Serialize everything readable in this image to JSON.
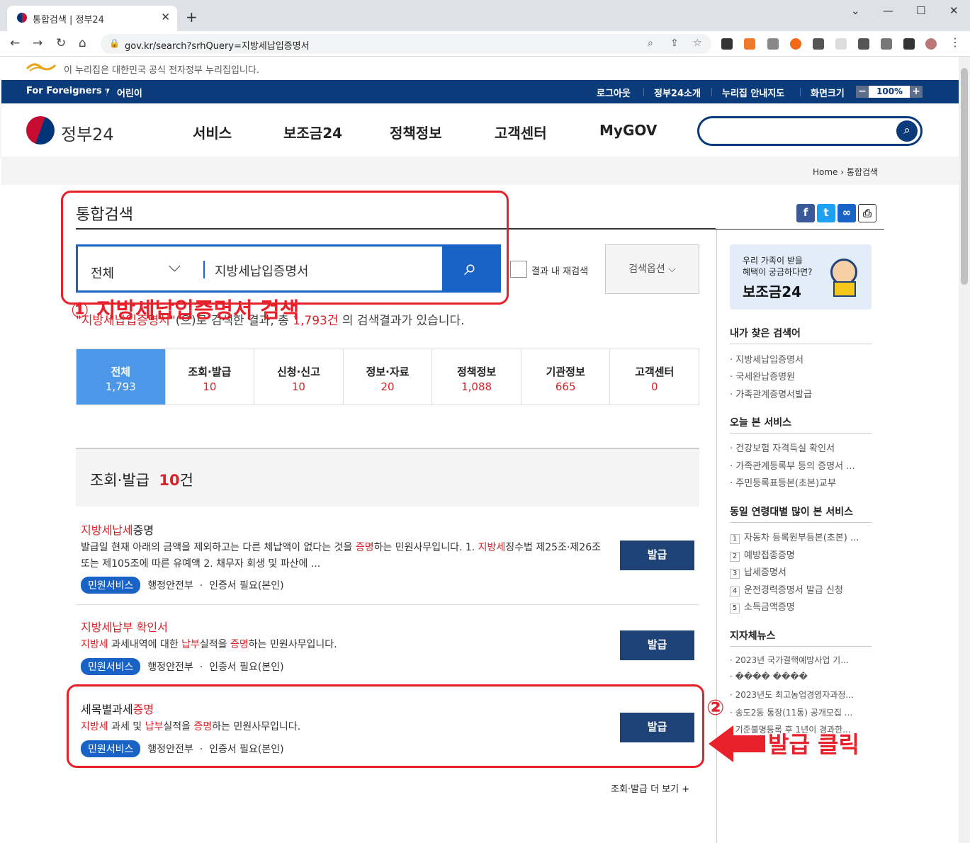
{
  "browser": {
    "tab_title": "통합검색 | 정부24",
    "url": "gov.kr/search?srhQuery=지방세납입증명서"
  },
  "notice": {
    "text": "이 누리집은 대한민국 공식 전자정부 누리집입니다."
  },
  "util": {
    "foreigners": "For Foreigners",
    "kids": "어린이",
    "logout": "로그아웃",
    "about": "정부24소개",
    "sitemap": "누리집 안내지도",
    "screen": "화면크기",
    "zoom": "100%"
  },
  "gnb": {
    "logo": "정부24",
    "menus": [
      "서비스",
      "보조금24",
      "정책정보",
      "고객센터",
      "MyGOV"
    ]
  },
  "breadcrumb": {
    "home": "Home",
    "current": "통합검색"
  },
  "main": {
    "title": "통합검색",
    "search": {
      "category": "전체",
      "query": "지방세납입증명서",
      "refine_label": "결과 내 재검색",
      "options_label": "검색옵션"
    },
    "result": {
      "keyword": "\"지방세납입증명서\"",
      "pre": "(으)로 검색한 결과, 총 ",
      "count": "1,793건",
      "post": " 의 검색결과가 있습니다."
    },
    "tabs": [
      {
        "label": "전체",
        "count": "1,793"
      },
      {
        "label": "조회·발급",
        "count": "10"
      },
      {
        "label": "신청·신고",
        "count": "10"
      },
      {
        "label": "정보·자료",
        "count": "20"
      },
      {
        "label": "정책정보",
        "count": "1,088"
      },
      {
        "label": "기관정보",
        "count": "665"
      },
      {
        "label": "고객센터",
        "count": "0"
      }
    ],
    "section": {
      "title": "조회·발급",
      "count": "10",
      "unit": "건"
    },
    "items": [
      {
        "title_a": "지방세납세",
        "title_b": "증명",
        "desc_parts": [
          "발급일 현재 아래의 금액을 제외하고는 다른 체납액이 없다는 것을 ",
          "증명",
          "하는 민원사무입니다. 1. ",
          "지방세",
          "징수법 제25조·제26조 또는 제105조에 따른 유예액 2. 채무자 회생 및 파산에 ..."
        ],
        "badge": "민원서비스",
        "org": "행정안전부",
        "auth": "인증서 필요(본인)",
        "button": "발급"
      },
      {
        "title_a": "지방세납부 확인서",
        "title_b": "",
        "desc_parts": [
          "지방세",
          " 과세내역에 대한 ",
          "납부",
          "실적을 ",
          "증명",
          "하는 민원사무입니다."
        ],
        "badge": "민원서비스",
        "org": "행정안전부",
        "auth": "인증서 필요(본인)",
        "button": "발급"
      },
      {
        "title_a": "세목별과세",
        "title_b": "증명",
        "desc_parts": [
          "지방세",
          " 과세 및 ",
          "납부",
          "실적을 ",
          "증명",
          "하는 민원사무입니다."
        ],
        "badge": "민원서비스",
        "org": "행정안전부",
        "auth": "인증서 필요(본인)",
        "button": "발급"
      }
    ],
    "more": "조회·발급 더 보기 +"
  },
  "sidebar": {
    "banner_l1": "우리 가족이 받을",
    "banner_l2": "혜택이 궁금하다면?",
    "banner_title": "보조금24",
    "recent_search_title": "내가 찾은 검색어",
    "recent_search": [
      "지방세납입증명서",
      "국세완납증명원",
      "가족관계증명서발급"
    ],
    "today_title": "오늘 본 서비스",
    "today": [
      "건강보험 자격득실 확인서",
      "가족관계등록부 등의 증명서 ...",
      "주민등록표등본(초본)교부"
    ],
    "popular_title": "동일 연령대별 많이 본 서비스",
    "popular": [
      "자동차 등록원부등본(초본) ...",
      "예방접종증명",
      "납세증명서",
      "운전경력증명서 발급 신청",
      "소득금액증명"
    ],
    "news_title": "지자체뉴스",
    "news": [
      "2023년 국가결핵예방사업 기...",
      "���� ����",
      "2023년도 최고농업경영자과정...",
      "송도2동 통장(11통) 공개모집 ...",
      "기준불명등록 후 1년이 경과한..."
    ]
  },
  "annotations": {
    "step1": "① 지방세납입증명서 검색",
    "step2": "②",
    "click": "발급 클릭"
  }
}
